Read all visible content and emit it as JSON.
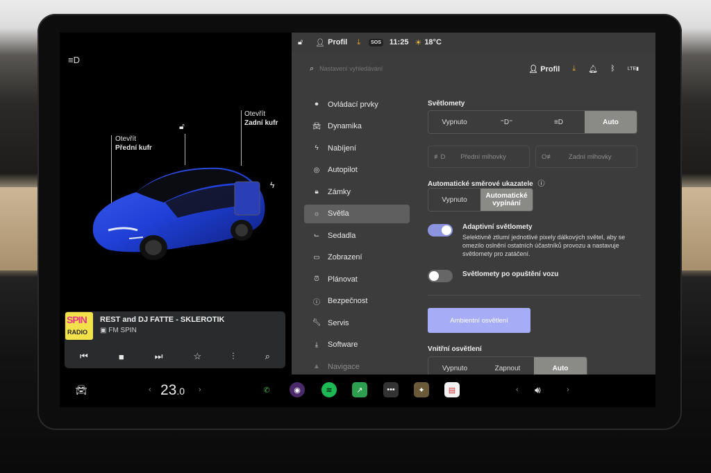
{
  "car": {
    "frunk_line1": "Otevřít",
    "frunk_line2": "Přední kufr",
    "trunk_line1": "Otevřít",
    "trunk_line2": "Zadní kufr"
  },
  "media": {
    "logo_top": "SPIN",
    "logo_bottom": "RADIO",
    "title": "REST and DJ FATTE - SKLEROTIK",
    "station": "FM SPIN"
  },
  "status": {
    "profile": "Profil",
    "sos": "SOS",
    "time": "11:25",
    "temp": "18°C"
  },
  "topbar": {
    "search_placeholder": "Nastavení vyhledávání",
    "profile": "Profil",
    "lte": "LTE"
  },
  "nav": [
    {
      "label": "Ovládací prvky",
      "icon": "toggle-icon"
    },
    {
      "label": "Dynamika",
      "icon": "car-icon"
    },
    {
      "label": "Nabíjení",
      "icon": "bolt-icon"
    },
    {
      "label": "Autopilot",
      "icon": "steering-wheel-icon"
    },
    {
      "label": "Zámky",
      "icon": "lock-icon"
    },
    {
      "label": "Světla",
      "icon": "sun-icon"
    },
    {
      "label": "Sedadla",
      "icon": "seat-icon"
    },
    {
      "label": "Zobrazení",
      "icon": "display-icon"
    },
    {
      "label": "Plánovat",
      "icon": "clock-icon"
    },
    {
      "label": "Bezpečnost",
      "icon": "shield-icon"
    },
    {
      "label": "Servis",
      "icon": "wrench-icon"
    },
    {
      "label": "Software",
      "icon": "download-icon"
    },
    {
      "label": "Navigace",
      "icon": "navigation-icon"
    }
  ],
  "lights": {
    "headlights_title": "Světlomety",
    "headlights_options": [
      "Vypnuto",
      "",
      "",
      "Auto"
    ],
    "headlights_selected": "Auto",
    "fog_front": "Přední mlhovky",
    "fog_rear": "Zadní mlhovky",
    "turn_title": "Automatické směrové ukazatele",
    "turn_off": "Vypnuto",
    "turn_auto": "Automatické vypínání",
    "adaptive_label": "Adaptivní světlomety",
    "adaptive_desc": "Selektivně ztlumí jednotlivé pixely dálkových světel, aby se omezilo oslnění ostatních účastníků provozu a nastavuje světlomety pro zatáčení.",
    "adaptive_on": true,
    "exit_label": "Světlomety po opuštění vozu",
    "exit_on": false,
    "ambient_button": "Ambientní osvětlení",
    "interior_title": "Vnitřní osvětlení",
    "interior_off": "Vypnuto",
    "interior_on": "Zapnout",
    "interior_auto": "Auto"
  },
  "dock": {
    "temperature": "23.0",
    "temperature_int": "23",
    "temperature_dec": ".0"
  },
  "colors": {
    "accent_toggle": "#8c94e0",
    "ambient_button": "#a6acf5",
    "download_orange": "#e8a53a",
    "car_blue": "#1f3fd6"
  }
}
